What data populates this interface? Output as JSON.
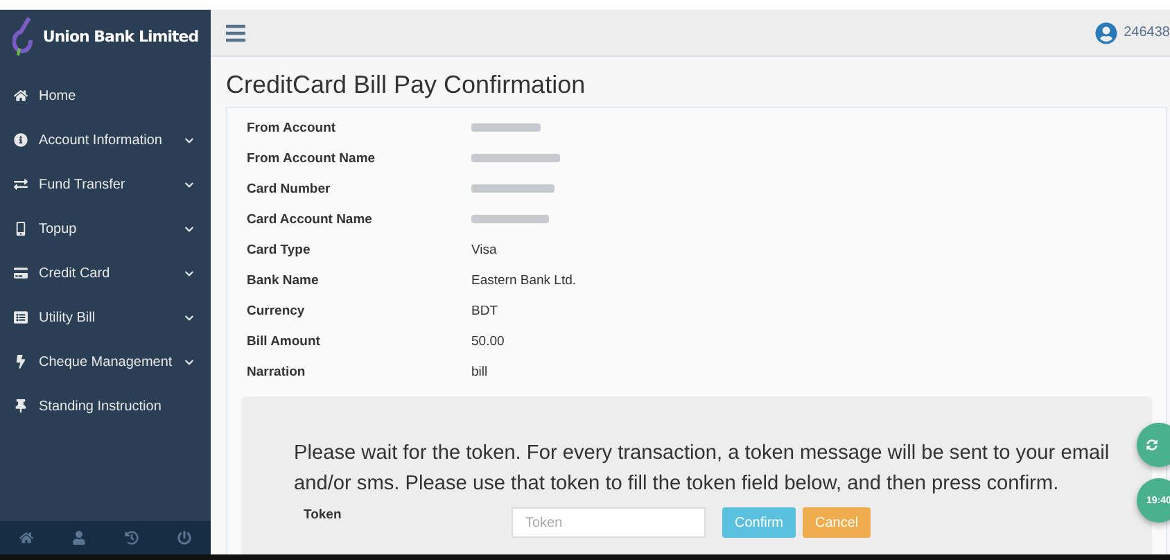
{
  "brand": {
    "name": "Union Bank Limited"
  },
  "user": {
    "id": "246438"
  },
  "sidebar": {
    "items": [
      {
        "kind": "home",
        "label": "Home",
        "expandable": false
      },
      {
        "kind": "info",
        "label": "Account Information",
        "expandable": true
      },
      {
        "kind": "transfer",
        "label": "Fund Transfer",
        "expandable": true
      },
      {
        "kind": "phone",
        "label": "Topup",
        "expandable": true
      },
      {
        "kind": "card",
        "label": "Credit Card",
        "expandable": true
      },
      {
        "kind": "bill",
        "label": "Utility Bill",
        "expandable": true
      },
      {
        "kind": "bolt",
        "label": "Cheque Management",
        "expandable": true
      },
      {
        "kind": "pin",
        "label": "Standing Instruction",
        "expandable": false
      }
    ],
    "footer": [
      {
        "kind": "home"
      },
      {
        "kind": "user"
      },
      {
        "kind": "history"
      },
      {
        "kind": "power"
      }
    ]
  },
  "page": {
    "title": "CreditCard Bill Pay Confirmation"
  },
  "details": [
    {
      "label": "From Account",
      "kind": "redacted"
    },
    {
      "label": "From Account Name",
      "kind": "redacted"
    },
    {
      "label": "Card Number",
      "kind": "redacted"
    },
    {
      "label": "Card Account Name",
      "kind": "redacted"
    },
    {
      "label": "Card Type",
      "kind": "text",
      "value": "Visa"
    },
    {
      "label": "Bank Name",
      "kind": "text",
      "value": "Eastern Bank Ltd."
    },
    {
      "label": "Currency",
      "kind": "text",
      "value": "BDT"
    },
    {
      "label": "Bill Amount",
      "kind": "text",
      "value": "50.00"
    },
    {
      "label": "Narration",
      "kind": "text",
      "value": "bill"
    }
  ],
  "token_panel": {
    "message": "Please wait for the token. For every transaction, a token message will be sent to your email and/or sms. Please use that token to fill the token field below, and then press confirm.",
    "label": "Token",
    "placeholder": "Token",
    "buttons": [
      {
        "kind": "primary",
        "label": "Confirm"
      },
      {
        "kind": "warning",
        "label": "Cancel"
      }
    ]
  },
  "floating": {
    "timer": "19:40"
  }
}
